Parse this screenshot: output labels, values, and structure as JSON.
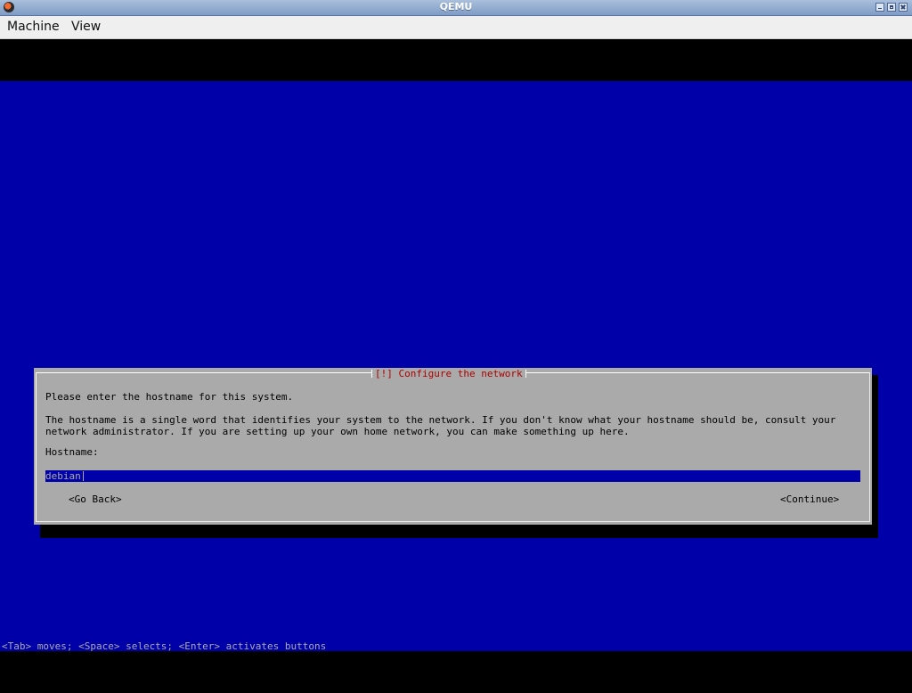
{
  "window": {
    "title": "QEMU",
    "app_icon": "qemu-icon"
  },
  "menubar": {
    "items": [
      "Machine",
      "View"
    ]
  },
  "installer": {
    "dialog_title": "[!] Configure the network",
    "prompt": "Please enter the hostname for this system.",
    "description": "The hostname is a single word that identifies your system to the network. If you don't know what your hostname should be, consult your network administrator. If you are setting up your own home network, you can make something up here.",
    "hostname_label": "Hostname:",
    "hostname_value": "debian",
    "back_button": "<Go Back>",
    "continue_button": "<Continue>"
  },
  "status_line": "<Tab> moves; <Space> selects; <Enter> activates buttons",
  "colors": {
    "screen_bg": "#0000a8",
    "dialog_bg": "#aaaaaa",
    "dialog_title": "#b00000",
    "field_bg": "#0000a8"
  }
}
